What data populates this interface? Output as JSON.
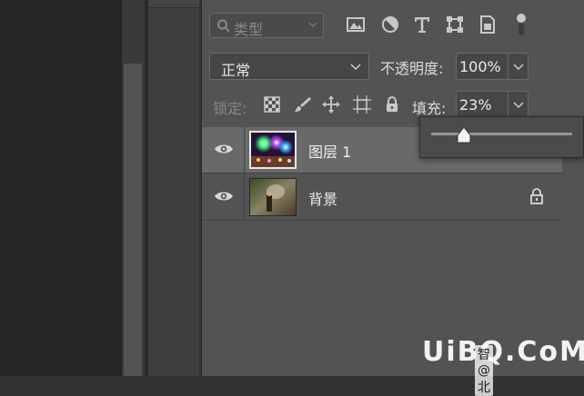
{
  "filter": {
    "kind_label": "类型",
    "icons": [
      "image-filter-icon",
      "adjustment-filter-icon",
      "type-filter-icon",
      "shape-filter-icon",
      "smart-object-filter-icon",
      "filter-toggle-icon"
    ]
  },
  "blend": {
    "mode": "正常"
  },
  "opacity": {
    "label": "不透明度:",
    "value": "100%"
  },
  "lock": {
    "label": "锁定:",
    "icons": [
      "lock-transparent-pixels-icon",
      "lock-image-pixels-icon",
      "lock-position-icon",
      "lock-artboard-icon",
      "lock-all-icon"
    ]
  },
  "fill": {
    "label": "填充:",
    "value": "23%",
    "slider_fraction": 0.23
  },
  "layers": [
    {
      "name": "图层 1",
      "visible": true,
      "selected": true,
      "locked": false
    },
    {
      "name": "背景",
      "visible": true,
      "selected": false,
      "locked": true
    }
  ],
  "watermark": {
    "brand": "UiBQ.CoM",
    "small": "智 @ 北"
  },
  "colors": {
    "panel": "#535353",
    "selected_row": "#696969",
    "workspace": "#262626"
  }
}
